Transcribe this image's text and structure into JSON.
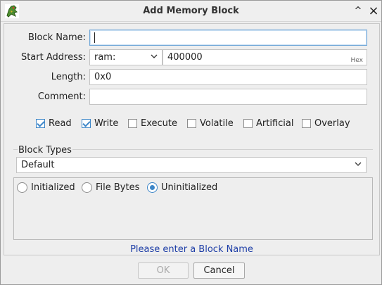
{
  "window": {
    "title": "Add Memory Block",
    "help_glyph": "^",
    "close_glyph": "×",
    "app_icon": "dragon-icon"
  },
  "form": {
    "block_name_label": "Block Name:",
    "block_name_value": "",
    "start_address_label": "Start Address:",
    "address_space": "ram:",
    "address_value": "400000",
    "address_suffix": "Hex",
    "length_label": "Length:",
    "length_value": "0x0",
    "comment_label": "Comment:",
    "comment_value": ""
  },
  "permissions": [
    {
      "label": "Read",
      "checked": true
    },
    {
      "label": "Write",
      "checked": true
    },
    {
      "label": "Execute",
      "checked": false
    },
    {
      "label": "Volatile",
      "checked": false
    },
    {
      "label": "Artificial",
      "checked": false
    },
    {
      "label": "Overlay",
      "checked": false
    }
  ],
  "block_types": {
    "title": "Block Types",
    "selected": "Default",
    "init_options": [
      {
        "label": "Initialized",
        "selected": false
      },
      {
        "label": "File Bytes",
        "selected": false
      },
      {
        "label": "Uninitialized",
        "selected": true
      }
    ]
  },
  "status_message": "Please enter a Block Name",
  "buttons": {
    "ok": "OK",
    "cancel": "Cancel"
  },
  "colors": {
    "accent": "#3d86c8",
    "status_text": "#1f3fa7"
  }
}
